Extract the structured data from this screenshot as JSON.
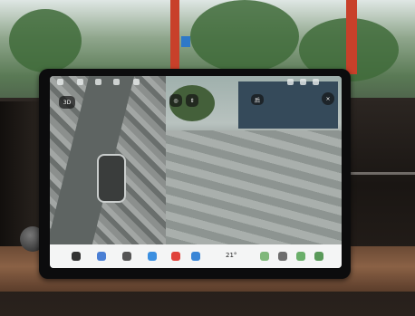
{
  "screen": {
    "view_toggle_label": "3D",
    "camera_overlay_label": "后",
    "dock": {
      "temperature": "21°"
    }
  }
}
